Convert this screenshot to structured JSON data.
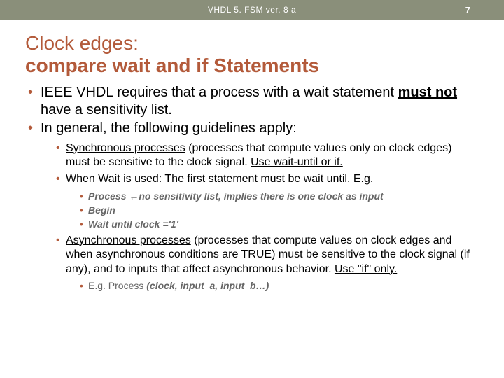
{
  "header": {
    "title": "VHDL 5. FSM ver. 8 a",
    "page": "7"
  },
  "title": {
    "line1": "Clock edges:",
    "line2": "compare wait and if Statements"
  },
  "bullets": {
    "b1_pre": "IEEE VHDL requires that a process with a wait statement ",
    "b1_mustnot": "must not",
    "b1_post": " have a sensitivity list.",
    "b2": "In general, the following guidelines apply:",
    "s1_pre": "Synchronous processes",
    "s1_mid": " (processes that compute values only on clock edges) must be sensitive to the clock signal. ",
    "s1_u2": "Use wait-until or if.",
    "s2_pre": "When Wait is used:",
    "s2_mid": " The first statement must be wait until, ",
    "s2_eg": "E.g.",
    "t1_a": "Process ",
    "t1_arrow": "←",
    "t1_b": "no sensitivity list, implies there is one clock as input",
    "t2": "Begin",
    "t3": "Wait until clock ='1'",
    "s3_pre": "Asynchronous processes",
    "s3_mid": " (processes that compute values on clock edges and when asynchronous conditions are TRUE) must be sensitive to the clock signal (if any), and to inputs that affect asynchronous behavior. ",
    "s3_u2": "Use \"if\" only.",
    "t4_a": "E.g. Process ",
    "t4_b": "(clock, input_a, input_b…)"
  }
}
